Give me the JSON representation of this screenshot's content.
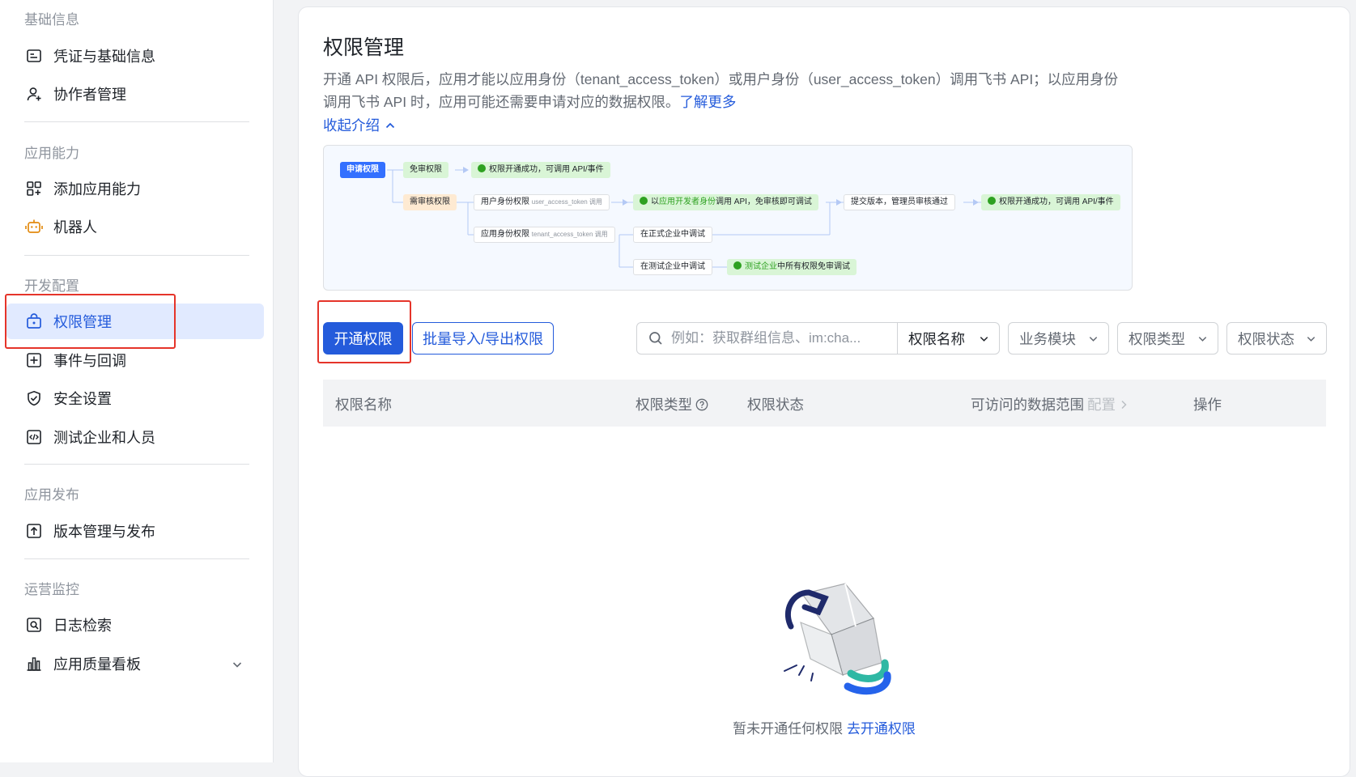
{
  "sidebar": {
    "sections": [
      {
        "title": "基础信息",
        "items": [
          {
            "label": "凭证与基础信息",
            "icon": "credential-icon"
          },
          {
            "label": "协作者管理",
            "icon": "user-add-icon"
          }
        ]
      },
      {
        "title": "应用能力",
        "items": [
          {
            "label": "添加应用能力",
            "icon": "apps-add-icon"
          },
          {
            "label": "机器人",
            "icon": "robot-icon"
          }
        ]
      },
      {
        "title": "开发配置",
        "items": [
          {
            "label": "权限管理",
            "icon": "lock-icon",
            "active": true
          },
          {
            "label": "事件与回调",
            "icon": "event-icon"
          },
          {
            "label": "安全设置",
            "icon": "shield-icon"
          },
          {
            "label": "测试企业和人员",
            "icon": "code-icon"
          }
        ]
      },
      {
        "title": "应用发布",
        "items": [
          {
            "label": "版本管理与发布",
            "icon": "upload-icon"
          }
        ]
      },
      {
        "title": "运营监控",
        "items": [
          {
            "label": "日志检索",
            "icon": "log-search-icon"
          },
          {
            "label": "应用质量看板",
            "icon": "bar-chart-icon"
          }
        ]
      }
    ]
  },
  "main": {
    "title": "权限管理",
    "description": "开通 API 权限后，应用才能以应用身份（tenant_access_token）或用户身份（user_access_token）调用飞书 API；以应用身份调用飞书 API 时，应用可能还需要申请对应的数据权限。",
    "learn_more": "了解更多",
    "collapse_label": "收起介绍",
    "flow": {
      "apply": "申请权限",
      "free": "免审权限",
      "free_result": "权限开通成功，可调用 API/事件",
      "review": "需审核权限",
      "user_token": "用户身份权限",
      "user_token_small": "user_access_token 调用",
      "dev_pre": "以",
      "dev_hl": "应用开发者身份",
      "dev_post": "调用 API，免审核即可调试",
      "submit": "提交版本，管理员审核通过",
      "final_result": "权限开通成功，可调用 API/事件",
      "tenant_token": "应用身份权限",
      "tenant_token_small": "tenant_access_token 调用",
      "prod_debug": "在正式企业中调试",
      "test_debug": "在测试企业中调试",
      "test_hl": "测试企业",
      "test_post": "中所有权限免审调试"
    },
    "actions": {
      "open_permission": "开通权限",
      "batch_import_export": "批量导入/导出权限",
      "search_placeholder": "例如：获取群组信息、im:cha...",
      "filter_name": "权限名称",
      "filter_module": "业务模块",
      "filter_type": "权限类型",
      "filter_status": "权限状态"
    },
    "table": {
      "columns": {
        "name": "权限名称",
        "type": "权限类型",
        "status": "权限状态",
        "data_scope": "可访问的数据范围",
        "data_scope_config": "配置",
        "actions": "操作"
      }
    },
    "empty": {
      "text": "暂未开通任何权限",
      "link": "去开通权限"
    }
  }
}
